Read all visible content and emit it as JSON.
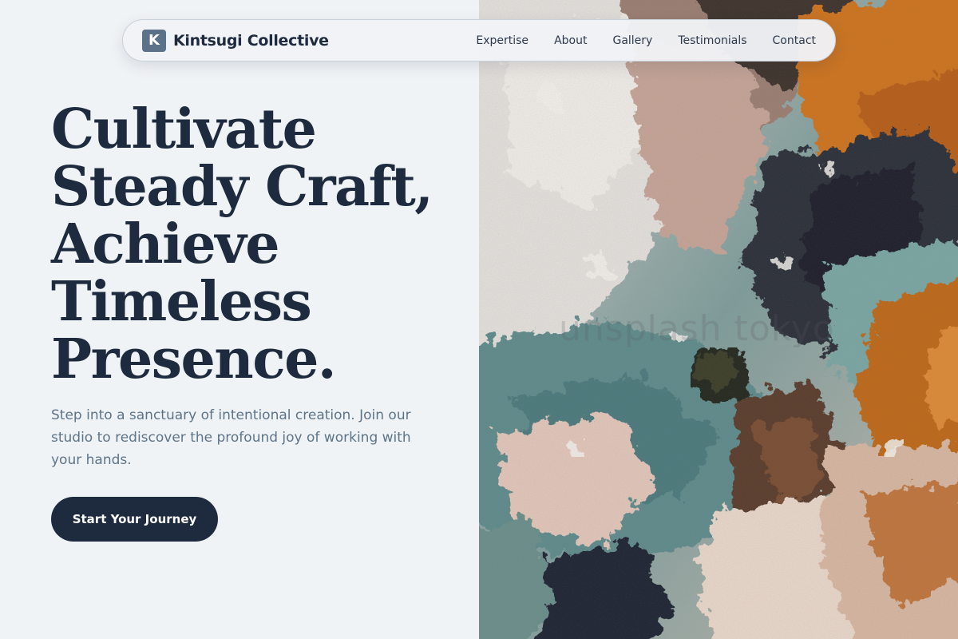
{
  "brand": {
    "mark": "K",
    "name": "Kintsugi Collective"
  },
  "nav": {
    "links": [
      "Expertise",
      "About",
      "Gallery",
      "Testimonials",
      "Contact"
    ]
  },
  "hero": {
    "headline": [
      "Cultivate",
      "Steady Craft,",
      "Achieve",
      "Timeless",
      "Presence."
    ],
    "subtext": "Step into a sanctuary of intentional creation. Join our studio to rediscover the profound joy of working with your hands.",
    "cta_label": "Start Your Journey",
    "image_alt": "Close-up of thick impasto paint strokes in white, orange, teal and dark tones"
  },
  "watermark": "unsplash tokyo",
  "colors": {
    "background": "#f0f3f6",
    "text_dark": "#1e2a3e",
    "text_muted": "#5d7488",
    "brand_mark": "#5b7288",
    "cta": "#1e2a3e"
  }
}
